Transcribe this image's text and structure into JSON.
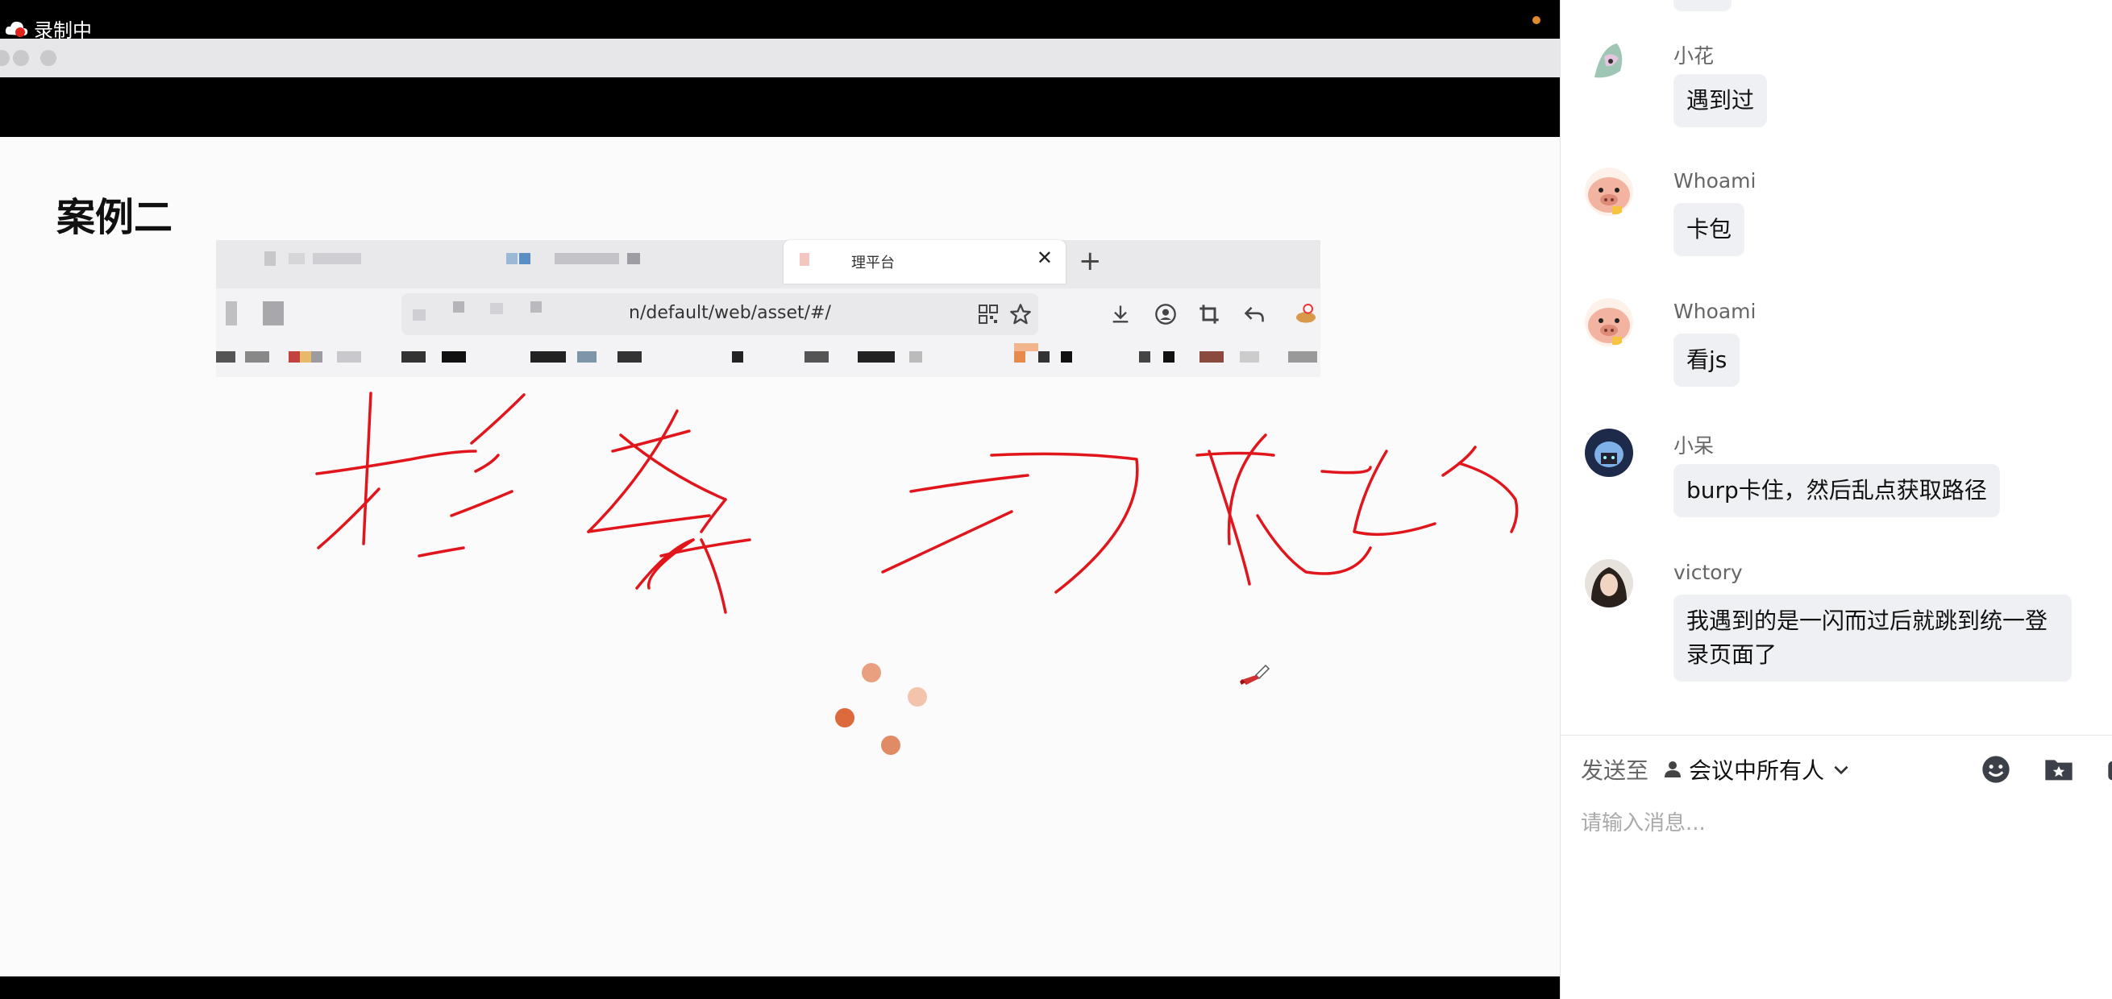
{
  "recording": {
    "label": "录制中"
  },
  "slide": {
    "title": "案例二",
    "browser_tab_title": "理平台",
    "tab_close": "✕",
    "new_tab": "+",
    "url_text": "n/default/web/asset/#/"
  },
  "chat": {
    "messages": [
      {
        "sender": "小花",
        "text": "遇到过"
      },
      {
        "sender": "Whoami",
        "text": "卡包"
      },
      {
        "sender": "Whoami",
        "text": "看js"
      },
      {
        "sender": "小呆",
        "text": "burp卡住，然后乱点获取路径"
      },
      {
        "sender": "victory",
        "text_line1": "我遇到的是一闪而过后就跳到统一登",
        "text_line2": "录页面了"
      }
    ],
    "send_to_label": "发送至",
    "recipient": "会议中所有人",
    "input_placeholder": "请输入消息..."
  },
  "colors": {
    "annotation_ink": "#e0161c",
    "recording_dot": "#e08a2e",
    "loading_dots": [
      "#e8a080",
      "#f3c3ac",
      "#dc6a3c",
      "#e08b66"
    ]
  },
  "icons": [
    "recording-cloud-icon",
    "emoji-icon",
    "folder-star-icon",
    "more-tools-icon",
    "person-icon",
    "chevron-down-icon",
    "pen-cursor-icon"
  ]
}
